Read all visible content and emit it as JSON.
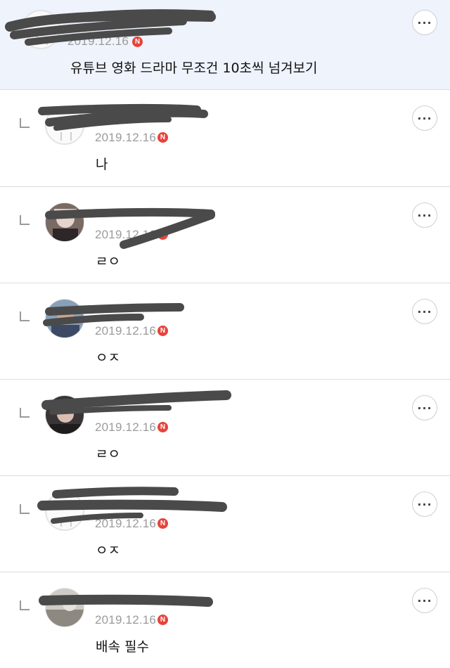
{
  "comments": [
    {
      "date": "2019.12.16",
      "badge": "N",
      "text": "유튜브 영화 드라마 무조건 10초씩 넘겨보기",
      "avatar": "default-avatar",
      "is_reply": false,
      "highlighted": true
    },
    {
      "date": "2019.12.16",
      "badge": "N",
      "text": "나",
      "avatar": "default-avatar",
      "is_reply": true
    },
    {
      "date": "2019.12.16",
      "badge": "N",
      "text": "ㄹㅇ",
      "avatar": "photo-avatar",
      "is_reply": true
    },
    {
      "date": "2019.12.16",
      "badge": "N",
      "text": "ㅇㅈ",
      "avatar": "photo-avatar",
      "is_reply": true
    },
    {
      "date": "2019.12.16",
      "badge": "N",
      "text": "ㄹㅇ",
      "avatar": "photo-avatar",
      "is_reply": true
    },
    {
      "date": "2019.12.16",
      "badge": "N",
      "text": "ㅇㅈ",
      "avatar": "default-avatar",
      "is_reply": true
    },
    {
      "date": "2019.12.16",
      "badge": "N",
      "text": "배속 필수",
      "avatar": "photo-avatar",
      "is_reply": true
    }
  ],
  "more_button_icon": "more-dots-icon",
  "colors": {
    "highlight_bg": "#eef3fc",
    "badge": "#e7433a",
    "date": "#9b9b9b"
  }
}
